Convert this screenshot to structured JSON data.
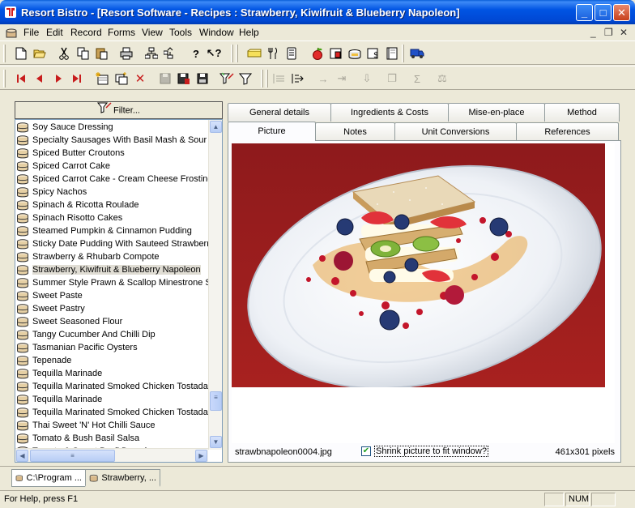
{
  "window": {
    "title": "Resort Bistro - [Resort Software - Recipes : Strawberry, Kiwifruit & Blueberry Napoleon]",
    "min_label": "_",
    "max_label": "□",
    "close_label": "✕"
  },
  "menubar": {
    "items": [
      "File",
      "Edit",
      "Record",
      "Forms",
      "View",
      "Tools",
      "Window",
      "Help"
    ],
    "mdi_min": "_",
    "mdi_restore": "❐",
    "mdi_close": "✕"
  },
  "toolbar": {
    "row1": [
      "new-icon",
      "open-icon",
      "cut-icon",
      "copy-icon",
      "paste-icon",
      "print-icon",
      "tree-icon",
      "tree-up-icon",
      "help-icon",
      "context-help-icon",
      "ingredient-icon",
      "utensils-icon",
      "menu-icon",
      "fruit-icon",
      "recipe-card-icon",
      "pot-icon",
      "costing-icon",
      "book-icon",
      "truck-icon"
    ],
    "row2": [
      "first-record-icon",
      "previous-record-icon",
      "next-record-icon",
      "last-record-icon",
      "new-record-icon",
      "duplicate-record-icon",
      "delete-record-icon",
      "save-icon",
      "save-as-icon",
      "save-all-icon",
      "filter-edit-icon",
      "filter-icon"
    ]
  },
  "left_panel": {
    "filter_label": "Filter...",
    "selected_index": 11,
    "items": [
      "Soy Sauce Dressing",
      "Specialty Sausages With Basil Mash & Sour Bi",
      "Spiced Butter Croutons",
      "Spiced Carrot Cake",
      "Spiced Carrot Cake - Cream Cheese Frosting",
      "Spicy Nachos",
      "Spinach & Ricotta Roulade",
      "Spinach Risotto Cakes",
      "Steamed Pumpkin & Cinnamon Pudding",
      "Sticky Date Pudding With Sauteed Strawberry",
      "Strawberry & Rhubarb Compote",
      "Strawberry, Kiwifruit & Blueberry Napoleon",
      "Summer Style Prawn & Scallop Minestrone Sou",
      "Sweet Paste",
      "Sweet Pastry",
      "Sweet Seasoned Flour",
      "Tangy Cucumber And Chilli Dip",
      "Tasmanian Pacific Oysters",
      "Tepenade",
      "Tequilla Marinade",
      "Tequilla Marinated Smoked Chicken Tostadas",
      "Tequilla Marinade",
      "Tequilla Marinated Smoked Chicken Tostadas",
      "Thai Sweet 'N' Hot Chilli Sauce",
      "Tomato & Bush Basil Salsa",
      "Tomato & Sweet Basil Dressing"
    ]
  },
  "tabs": {
    "row1": [
      "General details",
      "Ingredients & Costs",
      "Mise-en-place",
      "Method"
    ],
    "row2": [
      "Picture",
      "Notes",
      "Unit Conversions",
      "References"
    ],
    "active": "Picture"
  },
  "picture": {
    "filename": "strawbnapoleon0004.jpg",
    "shrink_label": "Shrink picture to fit window?",
    "shrink_checked": true,
    "check_mark": "✔",
    "size": "461x301 pixels"
  },
  "mdi_tabs": [
    "C:\\Program ...",
    "Strawberry, ..."
  ],
  "status": {
    "help": "For Help, press F1",
    "num": "NUM"
  },
  "colors": {
    "titlebar": "#0054e3",
    "chrome": "#ece9d8",
    "photo_background": "#8e1a1c",
    "plate": "#f2f4f8"
  }
}
